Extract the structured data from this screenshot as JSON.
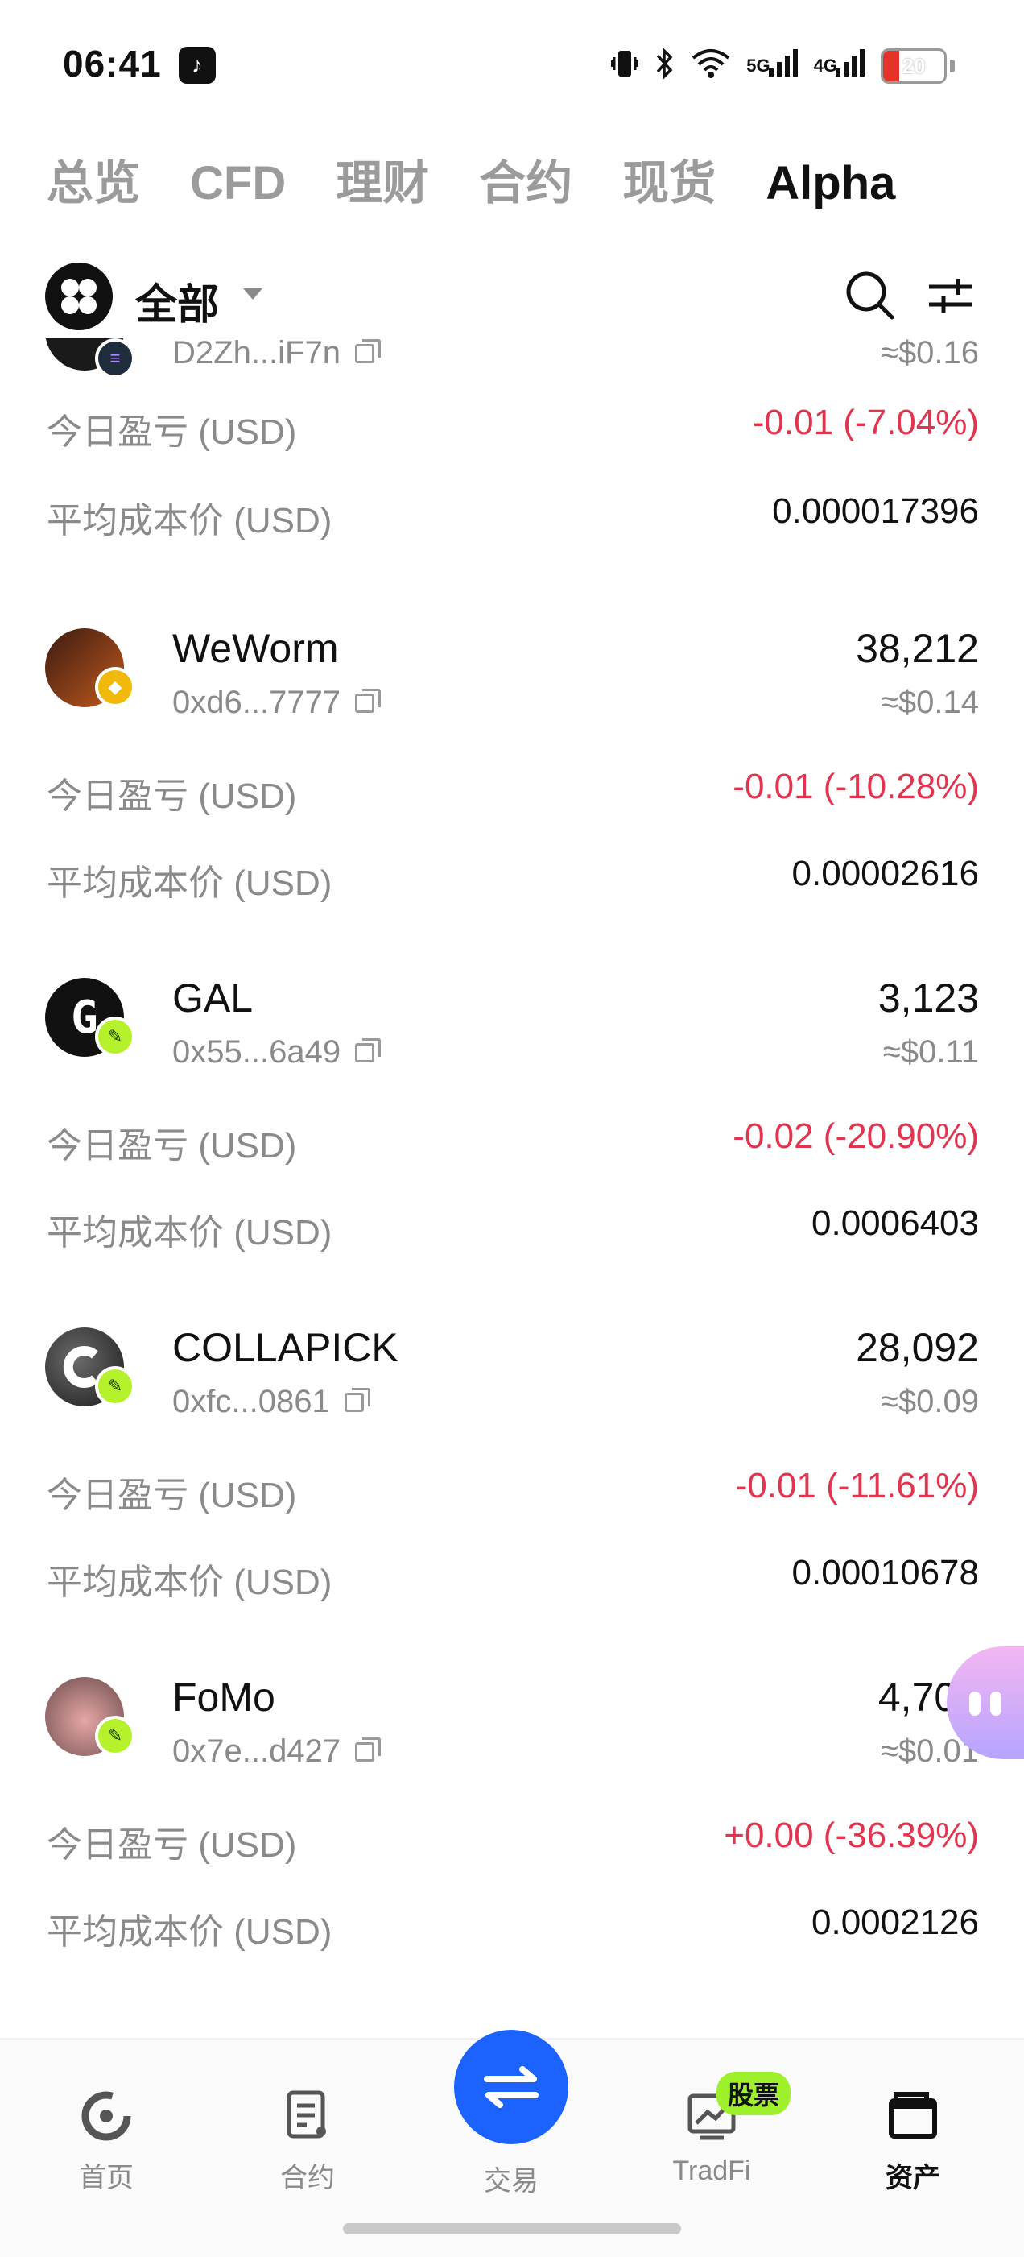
{
  "status_bar": {
    "time": "06:41",
    "network_5g": "5G",
    "network_4g": "4G",
    "battery": "20",
    "colors": {
      "battery_low": "#e5332a"
    }
  },
  "tabs": [
    {
      "label": "总览",
      "active": false
    },
    {
      "label": "CFD",
      "active": false
    },
    {
      "label": "理财",
      "active": false
    },
    {
      "label": "合约",
      "active": false
    },
    {
      "label": "现货",
      "active": false
    },
    {
      "label": "Alpha",
      "active": true
    }
  ],
  "filter": {
    "label": "全部",
    "icons": [
      "all-icon",
      "dropdown-caret",
      "search-icon",
      "filter-settings-icon"
    ]
  },
  "row_labels": {
    "pnl": "今日盈亏 (USD)",
    "avg_cost": "平均成本价 (USD)"
  },
  "tokens": [
    {
      "name": "",
      "address": "D2Zh...iF7n",
      "amount": "",
      "value": "≈$0.16",
      "pnl": "-0.01 (-7.04%)",
      "avg_cost": "0.000017396",
      "chain": "solana"
    },
    {
      "name": "WeWorm",
      "address": "0xd6...7777",
      "amount": "38,212",
      "value": "≈$0.14",
      "pnl": "-0.01 (-10.28%)",
      "avg_cost": "0.00002616",
      "chain": "bnb"
    },
    {
      "name": "GAL",
      "address": "0x55...6a49",
      "amount": "3,123",
      "value": "≈$0.11",
      "pnl": "-0.02 (-20.90%)",
      "avg_cost": "0.0006403",
      "chain": "feather"
    },
    {
      "name": "COLLAPICK",
      "address": "0xfc...0861",
      "amount": "28,092",
      "value": "≈$0.09",
      "pnl": "-0.01 (-11.61%)",
      "avg_cost": "0.00010678",
      "chain": "feather"
    },
    {
      "name": "FoMo",
      "address": "0x7e...d427",
      "amount": "4,701",
      "value": "≈$0.01",
      "pnl": "+0.00 (-36.39%)",
      "avg_cost": "0.0002126",
      "chain": "feather"
    }
  ],
  "colors": {
    "negative": "#e2334f",
    "accent_blue": "#1b62ff",
    "badge_green": "#9ef12a"
  },
  "bottom_nav": {
    "items": [
      {
        "label": "首页",
        "icon": "home-icon",
        "active": false
      },
      {
        "label": "合约",
        "icon": "contract-icon",
        "active": false
      },
      {
        "label": "交易",
        "icon": "swap-icon",
        "active": false
      },
      {
        "label": "TradFi",
        "icon": "chart-icon",
        "active": false
      },
      {
        "label": "资产",
        "icon": "wallet-icon",
        "active": true
      }
    ],
    "badge": "股票"
  }
}
